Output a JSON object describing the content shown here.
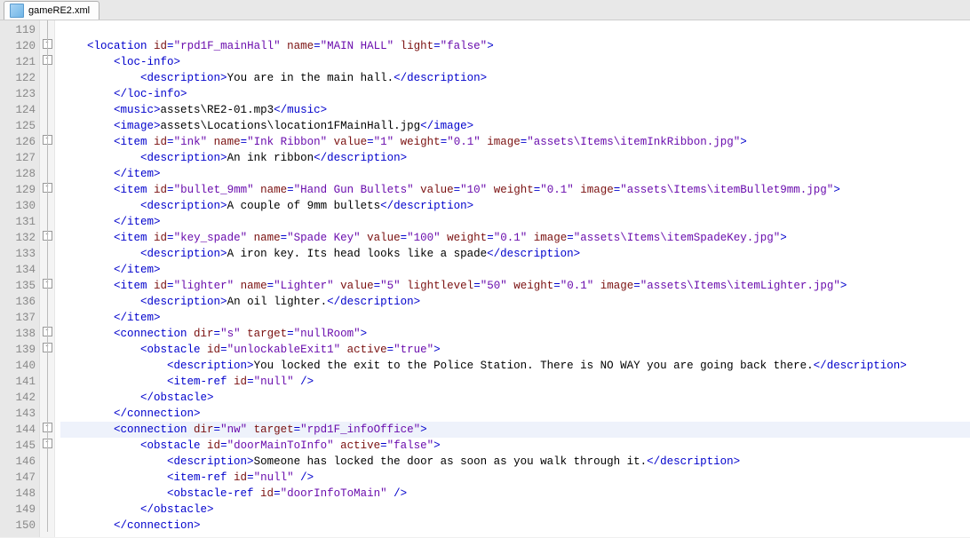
{
  "filename": "gameRE2.xml",
  "firstLine": 119,
  "lines": [
    {
      "n": 119,
      "fold": "",
      "hl": false,
      "tokens": []
    },
    {
      "n": 120,
      "fold": "box",
      "hl": false,
      "tokens": [
        {
          "c": "br",
          "t": "    <"
        },
        {
          "c": "tg",
          "t": "location"
        },
        {
          "c": "at",
          "t": " id"
        },
        {
          "c": "br",
          "t": "="
        },
        {
          "c": "st",
          "t": "\"rpd1F_mainHall\""
        },
        {
          "c": "at",
          "t": " name"
        },
        {
          "c": "br",
          "t": "="
        },
        {
          "c": "st",
          "t": "\"MAIN HALL\""
        },
        {
          "c": "at",
          "t": " light"
        },
        {
          "c": "br",
          "t": "="
        },
        {
          "c": "st",
          "t": "\"false\""
        },
        {
          "c": "br",
          "t": ">"
        }
      ]
    },
    {
      "n": 121,
      "fold": "box",
      "hl": false,
      "tokens": [
        {
          "c": "br",
          "t": "        <"
        },
        {
          "c": "tg",
          "t": "loc-info"
        },
        {
          "c": "br",
          "t": ">"
        }
      ]
    },
    {
      "n": 122,
      "fold": "",
      "hl": false,
      "tokens": [
        {
          "c": "br",
          "t": "            <"
        },
        {
          "c": "tg",
          "t": "description"
        },
        {
          "c": "br",
          "t": ">"
        },
        {
          "c": "tx",
          "t": "You are in the main hall."
        },
        {
          "c": "br",
          "t": "</"
        },
        {
          "c": "tg",
          "t": "description"
        },
        {
          "c": "br",
          "t": ">"
        }
      ]
    },
    {
      "n": 123,
      "fold": "",
      "hl": false,
      "tokens": [
        {
          "c": "br",
          "t": "        </"
        },
        {
          "c": "tg",
          "t": "loc-info"
        },
        {
          "c": "br",
          "t": ">"
        }
      ]
    },
    {
      "n": 124,
      "fold": "",
      "hl": false,
      "tokens": [
        {
          "c": "br",
          "t": "        <"
        },
        {
          "c": "tg",
          "t": "music"
        },
        {
          "c": "br",
          "t": ">"
        },
        {
          "c": "tx",
          "t": "assets\\RE2-01.mp3"
        },
        {
          "c": "br",
          "t": "</"
        },
        {
          "c": "tg",
          "t": "music"
        },
        {
          "c": "br",
          "t": ">"
        }
      ]
    },
    {
      "n": 125,
      "fold": "",
      "hl": false,
      "tokens": [
        {
          "c": "br",
          "t": "        <"
        },
        {
          "c": "tg",
          "t": "image"
        },
        {
          "c": "br",
          "t": ">"
        },
        {
          "c": "tx",
          "t": "assets\\Locations\\location1FMainHall.jpg"
        },
        {
          "c": "br",
          "t": "</"
        },
        {
          "c": "tg",
          "t": "image"
        },
        {
          "c": "br",
          "t": ">"
        }
      ]
    },
    {
      "n": 126,
      "fold": "box",
      "hl": false,
      "tokens": [
        {
          "c": "br",
          "t": "        <"
        },
        {
          "c": "tg",
          "t": "item"
        },
        {
          "c": "at",
          "t": " id"
        },
        {
          "c": "br",
          "t": "="
        },
        {
          "c": "st",
          "t": "\"ink\""
        },
        {
          "c": "at",
          "t": " name"
        },
        {
          "c": "br",
          "t": "="
        },
        {
          "c": "st",
          "t": "\"Ink Ribbon\""
        },
        {
          "c": "at",
          "t": " value"
        },
        {
          "c": "br",
          "t": "="
        },
        {
          "c": "st",
          "t": "\"1\""
        },
        {
          "c": "at",
          "t": " weight"
        },
        {
          "c": "br",
          "t": "="
        },
        {
          "c": "st",
          "t": "\"0.1\""
        },
        {
          "c": "at",
          "t": " image"
        },
        {
          "c": "br",
          "t": "="
        },
        {
          "c": "st",
          "t": "\"assets\\Items\\itemInkRibbon.jpg\""
        },
        {
          "c": "br",
          "t": ">"
        }
      ]
    },
    {
      "n": 127,
      "fold": "",
      "hl": false,
      "tokens": [
        {
          "c": "br",
          "t": "            <"
        },
        {
          "c": "tg",
          "t": "description"
        },
        {
          "c": "br",
          "t": ">"
        },
        {
          "c": "tx",
          "t": "An ink ribbon"
        },
        {
          "c": "br",
          "t": "</"
        },
        {
          "c": "tg",
          "t": "description"
        },
        {
          "c": "br",
          "t": ">"
        }
      ]
    },
    {
      "n": 128,
      "fold": "",
      "hl": false,
      "tokens": [
        {
          "c": "br",
          "t": "        </"
        },
        {
          "c": "tg",
          "t": "item"
        },
        {
          "c": "br",
          "t": ">"
        }
      ]
    },
    {
      "n": 129,
      "fold": "box",
      "hl": false,
      "tokens": [
        {
          "c": "br",
          "t": "        <"
        },
        {
          "c": "tg",
          "t": "item"
        },
        {
          "c": "at",
          "t": " id"
        },
        {
          "c": "br",
          "t": "="
        },
        {
          "c": "st",
          "t": "\"bullet_9mm\""
        },
        {
          "c": "at",
          "t": " name"
        },
        {
          "c": "br",
          "t": "="
        },
        {
          "c": "st",
          "t": "\"Hand Gun Bullets\""
        },
        {
          "c": "at",
          "t": " value"
        },
        {
          "c": "br",
          "t": "="
        },
        {
          "c": "st",
          "t": "\"10\""
        },
        {
          "c": "at",
          "t": " weight"
        },
        {
          "c": "br",
          "t": "="
        },
        {
          "c": "st",
          "t": "\"0.1\""
        },
        {
          "c": "at",
          "t": " image"
        },
        {
          "c": "br",
          "t": "="
        },
        {
          "c": "st",
          "t": "\"assets\\Items\\itemBullet9mm.jpg\""
        },
        {
          "c": "br",
          "t": ">"
        }
      ]
    },
    {
      "n": 130,
      "fold": "",
      "hl": false,
      "tokens": [
        {
          "c": "br",
          "t": "            <"
        },
        {
          "c": "tg",
          "t": "description"
        },
        {
          "c": "br",
          "t": ">"
        },
        {
          "c": "tx",
          "t": "A couple of 9mm bullets"
        },
        {
          "c": "br",
          "t": "</"
        },
        {
          "c": "tg",
          "t": "description"
        },
        {
          "c": "br",
          "t": ">"
        }
      ]
    },
    {
      "n": 131,
      "fold": "",
      "hl": false,
      "tokens": [
        {
          "c": "br",
          "t": "        </"
        },
        {
          "c": "tg",
          "t": "item"
        },
        {
          "c": "br",
          "t": ">"
        }
      ]
    },
    {
      "n": 132,
      "fold": "box",
      "hl": false,
      "tokens": [
        {
          "c": "br",
          "t": "        <"
        },
        {
          "c": "tg",
          "t": "item"
        },
        {
          "c": "at",
          "t": " id"
        },
        {
          "c": "br",
          "t": "="
        },
        {
          "c": "st",
          "t": "\"key_spade\""
        },
        {
          "c": "at",
          "t": " name"
        },
        {
          "c": "br",
          "t": "="
        },
        {
          "c": "st",
          "t": "\"Spade Key\""
        },
        {
          "c": "at",
          "t": " value"
        },
        {
          "c": "br",
          "t": "="
        },
        {
          "c": "st",
          "t": "\"100\""
        },
        {
          "c": "at",
          "t": " weight"
        },
        {
          "c": "br",
          "t": "="
        },
        {
          "c": "st",
          "t": "\"0.1\""
        },
        {
          "c": "at",
          "t": " image"
        },
        {
          "c": "br",
          "t": "="
        },
        {
          "c": "st",
          "t": "\"assets\\Items\\itemSpadeKey.jpg\""
        },
        {
          "c": "br",
          "t": ">"
        }
      ]
    },
    {
      "n": 133,
      "fold": "",
      "hl": false,
      "tokens": [
        {
          "c": "br",
          "t": "            <"
        },
        {
          "c": "tg",
          "t": "description"
        },
        {
          "c": "br",
          "t": ">"
        },
        {
          "c": "tx",
          "t": "A iron key. Its head looks like a spade"
        },
        {
          "c": "br",
          "t": "</"
        },
        {
          "c": "tg",
          "t": "description"
        },
        {
          "c": "br",
          "t": ">"
        }
      ]
    },
    {
      "n": 134,
      "fold": "",
      "hl": false,
      "tokens": [
        {
          "c": "br",
          "t": "        </"
        },
        {
          "c": "tg",
          "t": "item"
        },
        {
          "c": "br",
          "t": ">"
        }
      ]
    },
    {
      "n": 135,
      "fold": "box",
      "hl": false,
      "tokens": [
        {
          "c": "br",
          "t": "        <"
        },
        {
          "c": "tg",
          "t": "item"
        },
        {
          "c": "at",
          "t": " id"
        },
        {
          "c": "br",
          "t": "="
        },
        {
          "c": "st",
          "t": "\"lighter\""
        },
        {
          "c": "at",
          "t": " name"
        },
        {
          "c": "br",
          "t": "="
        },
        {
          "c": "st",
          "t": "\"Lighter\""
        },
        {
          "c": "at",
          "t": " value"
        },
        {
          "c": "br",
          "t": "="
        },
        {
          "c": "st",
          "t": "\"5\""
        },
        {
          "c": "at",
          "t": " lightlevel"
        },
        {
          "c": "br",
          "t": "="
        },
        {
          "c": "st",
          "t": "\"50\""
        },
        {
          "c": "at",
          "t": " weight"
        },
        {
          "c": "br",
          "t": "="
        },
        {
          "c": "st",
          "t": "\"0.1\""
        },
        {
          "c": "at",
          "t": " image"
        },
        {
          "c": "br",
          "t": "="
        },
        {
          "c": "st",
          "t": "\"assets\\Items\\itemLighter.jpg\""
        },
        {
          "c": "br",
          "t": ">"
        }
      ]
    },
    {
      "n": 136,
      "fold": "",
      "hl": false,
      "tokens": [
        {
          "c": "br",
          "t": "            <"
        },
        {
          "c": "tg",
          "t": "description"
        },
        {
          "c": "br",
          "t": ">"
        },
        {
          "c": "tx",
          "t": "An oil lighter."
        },
        {
          "c": "br",
          "t": "</"
        },
        {
          "c": "tg",
          "t": "description"
        },
        {
          "c": "br",
          "t": ">"
        }
      ]
    },
    {
      "n": 137,
      "fold": "",
      "hl": false,
      "tokens": [
        {
          "c": "br",
          "t": "        </"
        },
        {
          "c": "tg",
          "t": "item"
        },
        {
          "c": "br",
          "t": ">"
        }
      ]
    },
    {
      "n": 138,
      "fold": "box",
      "hl": false,
      "tokens": [
        {
          "c": "br",
          "t": "        <"
        },
        {
          "c": "tg",
          "t": "connection"
        },
        {
          "c": "at",
          "t": " dir"
        },
        {
          "c": "br",
          "t": "="
        },
        {
          "c": "st",
          "t": "\"s\""
        },
        {
          "c": "at",
          "t": " target"
        },
        {
          "c": "br",
          "t": "="
        },
        {
          "c": "st",
          "t": "\"nullRoom\""
        },
        {
          "c": "br",
          "t": ">"
        }
      ]
    },
    {
      "n": 139,
      "fold": "box",
      "hl": false,
      "tokens": [
        {
          "c": "br",
          "t": "            <"
        },
        {
          "c": "tg",
          "t": "obstacle"
        },
        {
          "c": "at",
          "t": " id"
        },
        {
          "c": "br",
          "t": "="
        },
        {
          "c": "st",
          "t": "\"unlockableExit1\""
        },
        {
          "c": "at",
          "t": " active"
        },
        {
          "c": "br",
          "t": "="
        },
        {
          "c": "st",
          "t": "\"true\""
        },
        {
          "c": "br",
          "t": ">"
        }
      ]
    },
    {
      "n": 140,
      "fold": "",
      "hl": false,
      "tokens": [
        {
          "c": "br",
          "t": "                <"
        },
        {
          "c": "tg",
          "t": "description"
        },
        {
          "c": "br",
          "t": ">"
        },
        {
          "c": "tx",
          "t": "You locked the exit to the Police Station. There is NO WAY you are going back there."
        },
        {
          "c": "br",
          "t": "</"
        },
        {
          "c": "tg",
          "t": "description"
        },
        {
          "c": "br",
          "t": ">"
        }
      ]
    },
    {
      "n": 141,
      "fold": "",
      "hl": false,
      "tokens": [
        {
          "c": "br",
          "t": "                <"
        },
        {
          "c": "tg",
          "t": "item-ref"
        },
        {
          "c": "at",
          "t": " id"
        },
        {
          "c": "br",
          "t": "="
        },
        {
          "c": "st",
          "t": "\"null\""
        },
        {
          "c": "br",
          "t": " />"
        }
      ]
    },
    {
      "n": 142,
      "fold": "",
      "hl": false,
      "tokens": [
        {
          "c": "br",
          "t": "            </"
        },
        {
          "c": "tg",
          "t": "obstacle"
        },
        {
          "c": "br",
          "t": ">"
        }
      ]
    },
    {
      "n": 143,
      "fold": "",
      "hl": false,
      "tokens": [
        {
          "c": "br",
          "t": "        </"
        },
        {
          "c": "tg",
          "t": "connection"
        },
        {
          "c": "br",
          "t": ">"
        }
      ]
    },
    {
      "n": 144,
      "fold": "box",
      "hl": true,
      "tokens": [
        {
          "c": "br",
          "t": "        <"
        },
        {
          "c": "tg",
          "t": "connection"
        },
        {
          "c": "at",
          "t": " dir"
        },
        {
          "c": "br",
          "t": "="
        },
        {
          "c": "st",
          "t": "\"nw\""
        },
        {
          "c": "at",
          "t": " target"
        },
        {
          "c": "br",
          "t": "="
        },
        {
          "c": "st",
          "t": "\"rpd1F_infoOffice\""
        },
        {
          "c": "br",
          "t": ">"
        }
      ]
    },
    {
      "n": 145,
      "fold": "box",
      "hl": false,
      "tokens": [
        {
          "c": "br",
          "t": "            <"
        },
        {
          "c": "tg",
          "t": "obstacle"
        },
        {
          "c": "at",
          "t": " id"
        },
        {
          "c": "br",
          "t": "="
        },
        {
          "c": "st",
          "t": "\"doorMainToInfo\""
        },
        {
          "c": "at",
          "t": " active"
        },
        {
          "c": "br",
          "t": "="
        },
        {
          "c": "st",
          "t": "\"false\""
        },
        {
          "c": "br",
          "t": ">"
        }
      ]
    },
    {
      "n": 146,
      "fold": "",
      "hl": false,
      "tokens": [
        {
          "c": "br",
          "t": "                <"
        },
        {
          "c": "tg",
          "t": "description"
        },
        {
          "c": "br",
          "t": ">"
        },
        {
          "c": "tx",
          "t": "Someone has locked the door as soon as you walk through it."
        },
        {
          "c": "br",
          "t": "</"
        },
        {
          "c": "tg",
          "t": "description"
        },
        {
          "c": "br",
          "t": ">"
        }
      ]
    },
    {
      "n": 147,
      "fold": "",
      "hl": false,
      "tokens": [
        {
          "c": "br",
          "t": "                <"
        },
        {
          "c": "tg",
          "t": "item-ref"
        },
        {
          "c": "at",
          "t": " id"
        },
        {
          "c": "br",
          "t": "="
        },
        {
          "c": "st",
          "t": "\"null\""
        },
        {
          "c": "br",
          "t": " />"
        }
      ]
    },
    {
      "n": 148,
      "fold": "",
      "hl": false,
      "tokens": [
        {
          "c": "br",
          "t": "                <"
        },
        {
          "c": "tg",
          "t": "obstacle-ref"
        },
        {
          "c": "at",
          "t": " id"
        },
        {
          "c": "br",
          "t": "="
        },
        {
          "c": "st",
          "t": "\"doorInfoToMain\""
        },
        {
          "c": "br",
          "t": " />"
        }
      ]
    },
    {
      "n": 149,
      "fold": "",
      "hl": false,
      "tokens": [
        {
          "c": "br",
          "t": "            </"
        },
        {
          "c": "tg",
          "t": "obstacle"
        },
        {
          "c": "br",
          "t": ">"
        }
      ]
    },
    {
      "n": 150,
      "fold": "",
      "hl": false,
      "tokens": [
        {
          "c": "br",
          "t": "        </"
        },
        {
          "c": "tg",
          "t": "connection"
        },
        {
          "c": "br",
          "t": ">"
        }
      ]
    }
  ]
}
